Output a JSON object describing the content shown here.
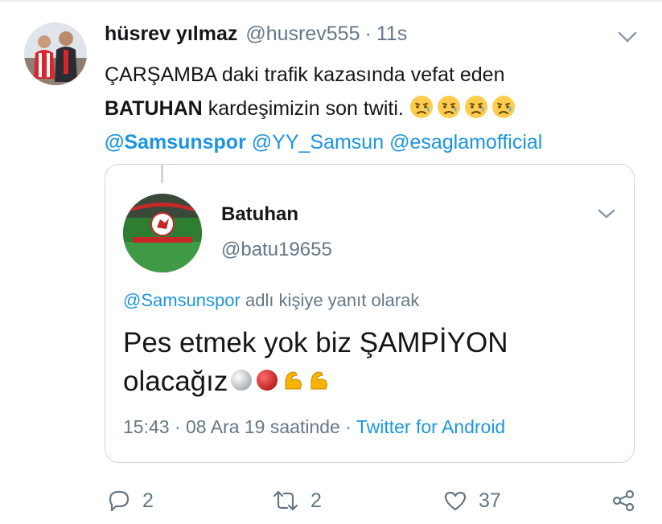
{
  "tweet": {
    "display_name": "hüsrev yılmaz",
    "handle": "@husrev555",
    "separator": "·",
    "time": "11s",
    "text_line1": "ÇARŞAMBA daki trafik kazasında vefat eden",
    "text_bold": "BATUHAN",
    "text_line2_rest": "kardeşimizin son twiti.",
    "emoji": "sad-but-relieved-face",
    "mentions": [
      "@Samsunspor",
      "@YY_Samsun",
      "@esaglamofficial"
    ]
  },
  "quoted": {
    "display_name": "Batuhan",
    "handle": "@batu19655",
    "reply_mention": "@Samsunspor",
    "reply_rest": "adlı kişiye yanıt olarak",
    "text_line1": "Pes etmek yok biz ŞAMPİYON",
    "text_line2": "olacağız",
    "emojis": [
      "white-circle",
      "red-circle",
      "flexed-biceps",
      "flexed-biceps"
    ],
    "timestamp": "15:43 · 08 Ara 19 saatinde ·",
    "source": "Twitter for Android"
  },
  "actions": {
    "reply_count": "2",
    "retweet_count": "2",
    "like_count": "37"
  },
  "colors": {
    "link": "#1b95e0",
    "secondary": "#657786",
    "border": "#ccd6dd"
  }
}
